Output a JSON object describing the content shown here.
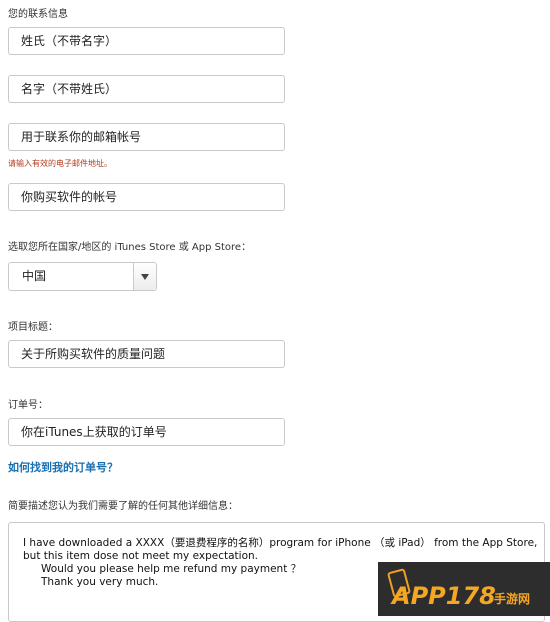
{
  "contact": {
    "section_label": "您的联系信息",
    "last_name_placeholder": "姓氏（不带名字）",
    "first_name_placeholder": "名字（不带姓氏）",
    "email_placeholder": "用于联系你的邮箱帐号",
    "email_error": "请输入有效的电子邮件地址。",
    "account_placeholder": "你购买软件的帐号"
  },
  "region": {
    "label": "选取您所在国家/地区的 iTunes Store 或 App Store：",
    "selected": "中国"
  },
  "subject": {
    "label": "项目标题：",
    "value": "关于所购买软件的质量问题"
  },
  "order": {
    "label": "订单号：",
    "value": "你在iTunes上获取的订单号",
    "help_link": "如何找到我的订单号？"
  },
  "details": {
    "label": "简要描述您认为我们需要了解的任何其他详细信息：",
    "lines": [
      "I have downloaded a XXXX（要退费程序的名称）program for iPhone （或 iPad） from the App Store,",
      "but this item dose not meet my expectation.",
      "Would you please help me refund my payment ？",
      "Thank you very much."
    ]
  },
  "watermark": {
    "brand": "APP178",
    "tagline": "手游网"
  },
  "colors": {
    "link": "#1a6fb0",
    "error": "#b23b1e",
    "watermark_accent": "#f5a623"
  }
}
